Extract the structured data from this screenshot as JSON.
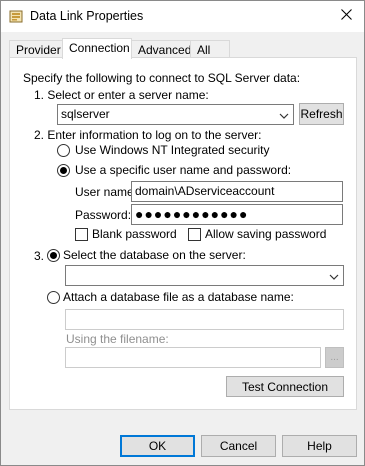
{
  "window": {
    "title": "Data Link Properties",
    "icons": {
      "app": "data-link-app-icon",
      "close": "close-icon"
    }
  },
  "tabs": [
    {
      "label": "Provider",
      "active": false
    },
    {
      "label": "Connection",
      "active": true
    },
    {
      "label": "Advanced",
      "active": false
    },
    {
      "label": "All",
      "active": false
    }
  ],
  "connection": {
    "intro": "Specify the following to connect to SQL Server data:",
    "step1_label": "1. Select or enter a server name:",
    "server_name": "sqlserver",
    "refresh_label": "Refresh",
    "step2_label": "2. Enter information to log on to the server:",
    "auth_options": {
      "windows_nt": "Use Windows NT Integrated security",
      "specific_user": "Use a specific user name and password:",
      "selected": "specific_user"
    },
    "username_label": "User name:",
    "username_value": "domain\\ADserviceaccount",
    "password_label": "Password:",
    "password_value": "●●●●●●●●●●●●",
    "blank_password_label": "Blank password",
    "blank_password_checked": false,
    "allow_saving_label": "Allow saving password",
    "allow_saving_checked": false,
    "step3_number": "3.",
    "db_options": {
      "select_db": "Select the database on the server:",
      "attach_file": "Attach a database file as a database name:",
      "selected": "select_db"
    },
    "database_value": "",
    "attach_name_value": "",
    "using_filename_label": "Using the filename:",
    "filename_value": "",
    "browse_label": "...",
    "test_connection_label": "Test Connection"
  },
  "footer": {
    "ok_label": "OK",
    "cancel_label": "Cancel",
    "help_label": "Help"
  }
}
